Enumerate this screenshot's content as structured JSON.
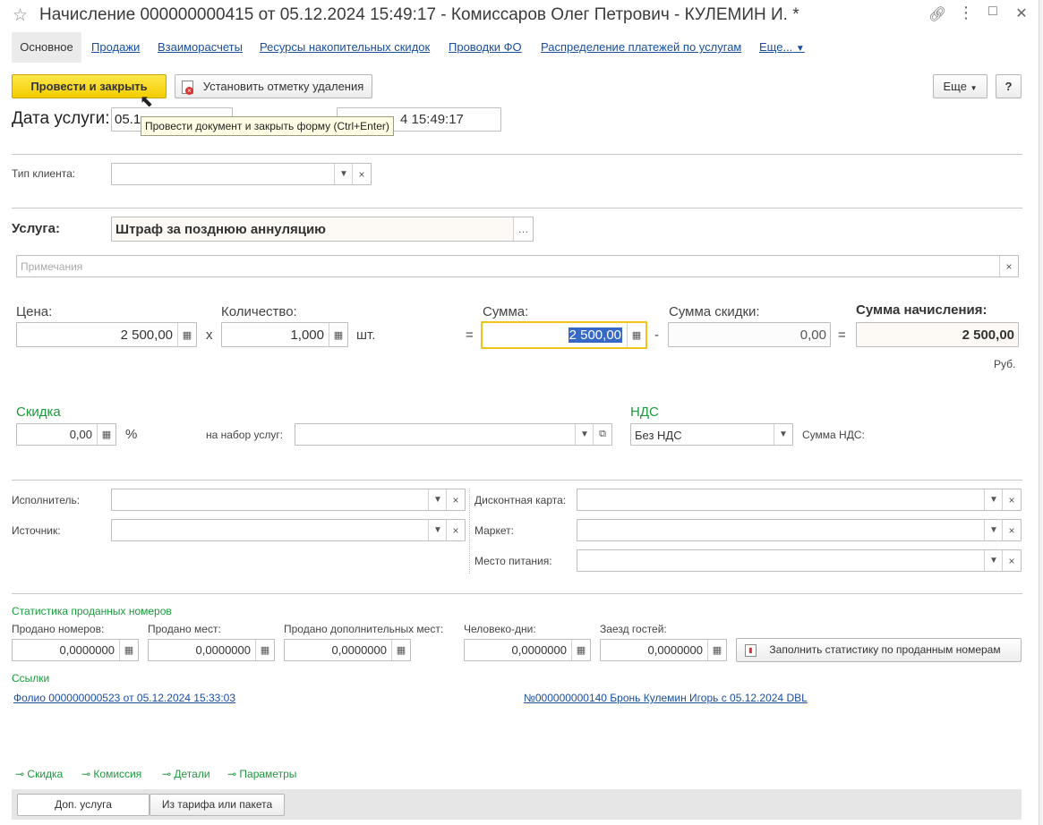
{
  "window": {
    "title": "Начисление 000000000415 от 05.12.2024 15:49:17 - Комиссаров Олег Петрович - КУЛЕМИН И. *"
  },
  "tabs": {
    "active": "Основное",
    "links": [
      "Продажи",
      "Взаиморасчеты",
      "Ресурсы накопительных скидок",
      "Проводки ФО",
      "Распределение платежей по услугам",
      "Еще..."
    ]
  },
  "toolbar": {
    "post_close": "Провести и закрыть",
    "set_delete_mark": "Установить отметку удаления",
    "more": "Еще",
    "help": "?"
  },
  "tooltip": "Провести документ и закрыть форму (Ctrl+Enter)",
  "service_date": {
    "label": "Дата услуги:",
    "date_visible": "05.1",
    "doc_datetime_visible": "4 15:49:17"
  },
  "client_type": {
    "label": "Тип клиента:",
    "value": ""
  },
  "service": {
    "label": "Услуга:",
    "value": "Штраф за позднюю аннуляцию"
  },
  "notes": {
    "placeholder": "Примечания"
  },
  "price": {
    "label": "Цена:",
    "value": "2 500,00"
  },
  "quantity": {
    "label": "Количество:",
    "value": "1,000",
    "unit": "шт."
  },
  "sum": {
    "label": "Сумма:",
    "value": "2 500,00"
  },
  "discount_sum": {
    "label": "Сумма скидки:",
    "value": "0,00"
  },
  "total": {
    "label": "Сумма начисления:",
    "value": "2 500,00",
    "currency": "Руб."
  },
  "operators": {
    "times": "x",
    "equals": "=",
    "minus": "-"
  },
  "discount": {
    "label": "Скидка",
    "value": "0,00",
    "unit": "%",
    "set_label": "на набор услуг:",
    "set_value": ""
  },
  "vat": {
    "label": "НДС",
    "value": "Без НДС",
    "sum_label": "Сумма НДС:"
  },
  "extra": {
    "executor": "Исполнитель:",
    "source": "Источник:",
    "discount_card": "Дисконтная карта:",
    "market": "Маркет:",
    "meal_place": "Место питания:"
  },
  "stats": {
    "title": "Статистика проданных номеров",
    "rooms_sold": {
      "label": "Продано номеров:",
      "value": "0,0000000"
    },
    "beds_sold": {
      "label": "Продано мест:",
      "value": "0,0000000"
    },
    "extra_beds_sold": {
      "label": "Продано дополнительных мест:",
      "value": "0,0000000"
    },
    "person_days": {
      "label": "Человеко-дни:",
      "value": "0,0000000"
    },
    "guest_arrivals": {
      "label": "Заезд гостей:",
      "value": "0,0000000"
    },
    "fill_button": "Заполнить статистику по проданным номерам"
  },
  "links": {
    "title": "Ссылки",
    "folio": "Фолио 000000000523 от 05.12.2024 15:33:03",
    "booking": "№000000000140 Бронь Кулемин Игорь с 05.12.2024 DBL"
  },
  "collapsible": [
    "Скидка",
    "Комиссия",
    "Детали",
    "Параметры"
  ],
  "bottom_tabs": {
    "active": "Доп. услуга",
    "other": "Из тарифа или пакета"
  },
  "colors": {
    "accent_yellow": "#f3cd00",
    "link_blue": "#1a4fa0",
    "group_green": "#1c9a3c",
    "focus_border": "#f0c419"
  }
}
